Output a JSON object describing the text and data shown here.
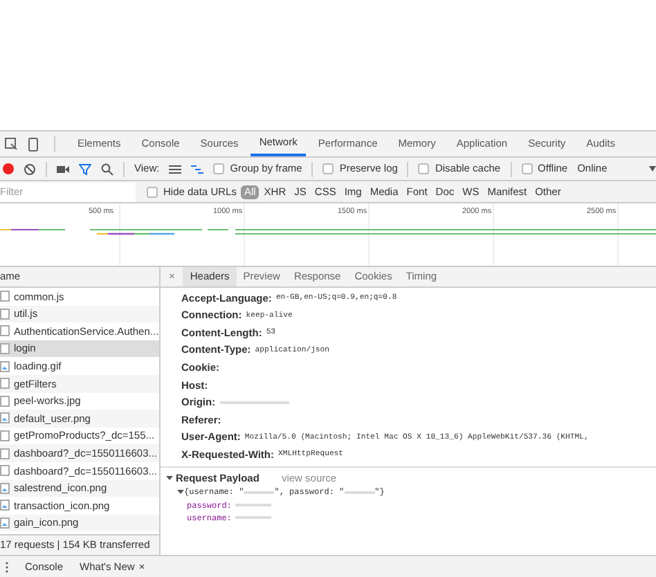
{
  "panel_tabs": [
    {
      "label": "Elements",
      "selected": false
    },
    {
      "label": "Console",
      "selected": false
    },
    {
      "label": "Sources",
      "selected": false
    },
    {
      "label": "Network",
      "selected": true
    },
    {
      "label": "Performance",
      "selected": false
    },
    {
      "label": "Memory",
      "selected": false
    },
    {
      "label": "Application",
      "selected": false
    },
    {
      "label": "Security",
      "selected": false
    },
    {
      "label": "Audits",
      "selected": false
    }
  ],
  "toolbar": {
    "recording": true,
    "view_label": "View:",
    "options": [
      {
        "label": "Group by frame",
        "checked": false
      },
      {
        "label": "Preserve log",
        "checked": false
      },
      {
        "label": "Disable cache",
        "checked": false
      },
      {
        "label": "Offline",
        "checked": false
      }
    ],
    "throttling": "Online"
  },
  "filter": {
    "placeholder": "Filter",
    "hide_data_urls": {
      "label": "Hide data URLs",
      "checked": false
    },
    "types": [
      {
        "label": "All",
        "selected": true
      },
      {
        "label": "XHR",
        "selected": false
      },
      {
        "label": "JS",
        "selected": false
      },
      {
        "label": "CSS",
        "selected": false
      },
      {
        "label": "Img",
        "selected": false
      },
      {
        "label": "Media",
        "selected": false
      },
      {
        "label": "Font",
        "selected": false
      },
      {
        "label": "Doc",
        "selected": false
      },
      {
        "label": "WS",
        "selected": false
      },
      {
        "label": "Manifest",
        "selected": false
      },
      {
        "label": "Other",
        "selected": false
      }
    ]
  },
  "timeline": {
    "ticks": [
      "500 ms",
      "1000 ms",
      "1500 ms",
      "2000 ms",
      "2500 ms"
    ]
  },
  "requests": {
    "column": "ame",
    "rows": [
      {
        "name": "common.js",
        "kind": "file",
        "selected": false
      },
      {
        "name": "util.js",
        "kind": "file",
        "selected": false
      },
      {
        "name": "AuthenticationService.Authen...",
        "kind": "file",
        "selected": false
      },
      {
        "name": "login",
        "kind": "file",
        "selected": true
      },
      {
        "name": "loading.gif",
        "kind": "image",
        "selected": false
      },
      {
        "name": "getFilters",
        "kind": "file",
        "selected": false
      },
      {
        "name": "peel-works.jpg",
        "kind": "file",
        "selected": false
      },
      {
        "name": "default_user.png",
        "kind": "image",
        "selected": false
      },
      {
        "name": "getPromoProducts?_dc=155...",
        "kind": "file",
        "selected": false
      },
      {
        "name": "dashboard?_dc=1550116603...",
        "kind": "file",
        "selected": false
      },
      {
        "name": "dashboard?_dc=1550116603...",
        "kind": "file",
        "selected": false
      },
      {
        "name": "salestrend_icon.png",
        "kind": "image",
        "selected": false
      },
      {
        "name": "transaction_icon.png",
        "kind": "image",
        "selected": false
      },
      {
        "name": "gain_icon.png",
        "kind": "image",
        "selected": false
      }
    ],
    "summary": "17 requests | 154 KB transferred"
  },
  "details": {
    "close": "×",
    "tabs": [
      {
        "label": "Headers",
        "selected": true
      },
      {
        "label": "Preview",
        "selected": false
      },
      {
        "label": "Response",
        "selected": false
      },
      {
        "label": "Cookies",
        "selected": false
      },
      {
        "label": "Timing",
        "selected": false
      }
    ],
    "headers": [
      {
        "name": "Accept-Language:",
        "value": "en-GB,en-US;q=0.9,en;q=0.8"
      },
      {
        "name": "Connection:",
        "value": "keep-alive"
      },
      {
        "name": "Content-Length:",
        "value": "53"
      },
      {
        "name": "Content-Type:",
        "value": "application/json"
      },
      {
        "name": "Cookie:"
      },
      {
        "name": "Host:"
      },
      {
        "name": "Origin:"
      },
      {
        "name": "Referer:"
      },
      {
        "name": "User-Agent:",
        "value": "Mozilla/5.0 (Macintosh; Intel Mac OS X 10_13_6) AppleWebKit/537.36 (KHTML,"
      },
      {
        "name": "X-Requested-With:",
        "value": "XMLHttpRequest"
      }
    ],
    "payload": {
      "title": "Request Payload",
      "expanded": true,
      "view_source": "view source",
      "object": {
        "open": "{username: \"",
        "middle": "\", password: \"",
        "close": "\"}"
      },
      "keys": [
        "password:",
        "username:"
      ]
    }
  },
  "drawer": {
    "tabs": [
      {
        "label": "Console",
        "closable": false
      },
      {
        "label": "What's New",
        "closable": true
      }
    ],
    "close": "×"
  }
}
